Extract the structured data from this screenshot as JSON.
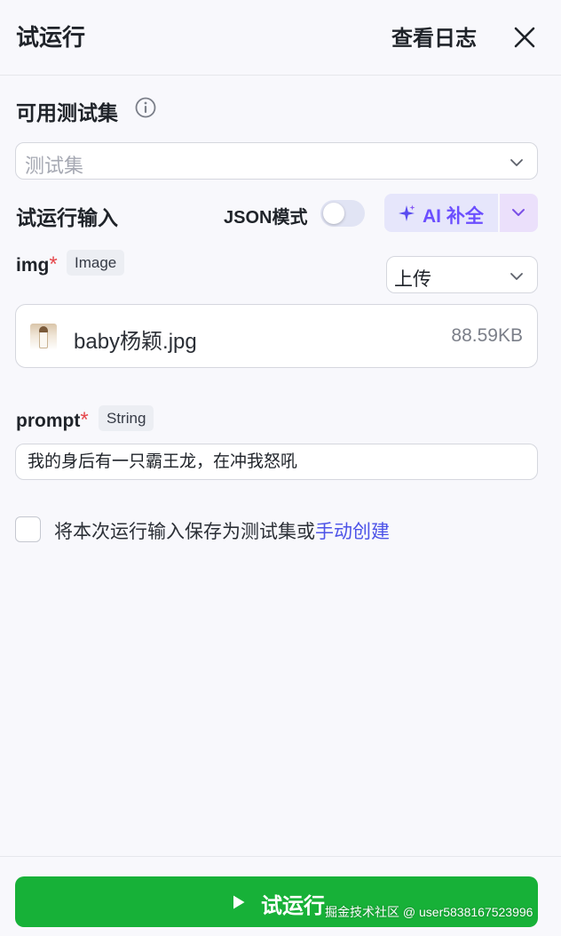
{
  "header": {
    "title": "试运行",
    "log_link": "查看日志",
    "close_icon": "close-icon"
  },
  "test_set": {
    "label": "可用测试集",
    "info_icon": "info-icon",
    "placeholder": "测试集"
  },
  "run_input": {
    "label": "试运行输入",
    "json_mode_label": "JSON模式",
    "json_mode_on": false,
    "ai_button_label": "AI 补全",
    "ai_icon": "sparkle-icon"
  },
  "fields": {
    "img": {
      "name": "img",
      "required_mark": "*",
      "type_tag": "Image",
      "source_select": "上传",
      "file_name": "baby杨颖.jpg",
      "file_size": "88.59KB"
    },
    "prompt": {
      "name": "prompt",
      "required_mark": "*",
      "type_tag": "String",
      "value": "我的身后有一只霸王龙，在冲我怒吼"
    }
  },
  "save_option": {
    "checked": false,
    "text": "将本次运行输入保存为测试集或",
    "link": "手动创建"
  },
  "footer": {
    "run_button_label": "试运行",
    "play_icon": "play-icon",
    "watermark": "掘金技术社区 @ user5838167523996"
  },
  "colors": {
    "accent": "#4d53e8",
    "run_green": "#17b138",
    "required_red": "#e5484d",
    "ai_purple": "#6b4eff"
  }
}
